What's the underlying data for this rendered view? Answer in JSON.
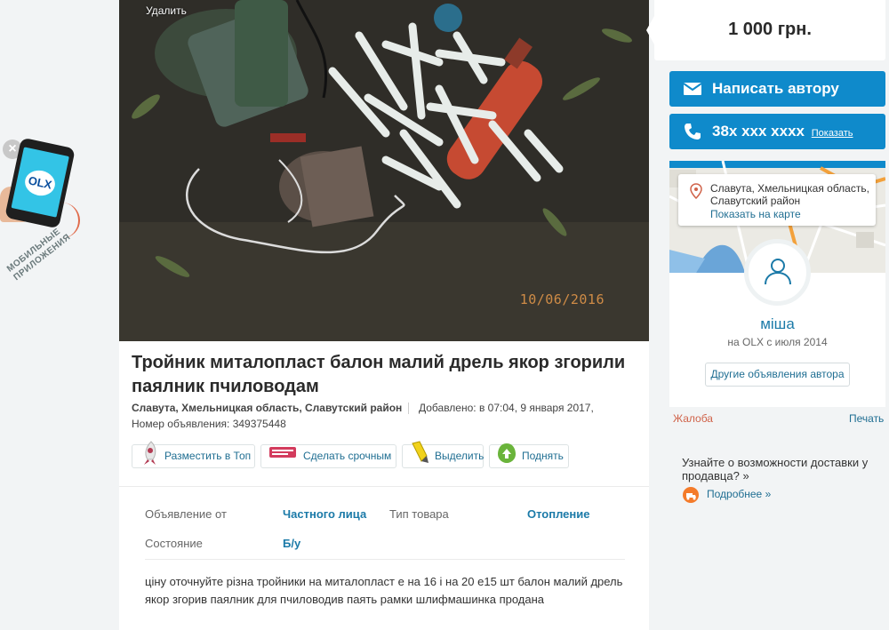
{
  "promo": {
    "close": "×",
    "logo": "OLX",
    "label": "мобильные приложения",
    "icons": [
      "close-icon",
      "phone-icon",
      "arrow-icon"
    ]
  },
  "photo": {
    "delete_label": "Удалить",
    "date_stamp": "10/06/2016"
  },
  "ad": {
    "title": "Тройник миталопласт балон малий дрель якор згорили паялник пчиловодам",
    "location": "Славута, Хмельницкая область, Славутский район",
    "added": "Добавлено: в 07:04, 9 января 2017,",
    "ad_number": "Номер объявления: 349375448"
  },
  "actions": [
    {
      "label": "Разместить в Топ",
      "icon": "rocket-icon"
    },
    {
      "label": "Сделать срочным",
      "icon": "urgent-tag-icon"
    },
    {
      "label": "Выделить",
      "icon": "marker-icon"
    },
    {
      "label": "Поднять",
      "icon": "up-arrow-icon"
    }
  ],
  "params": [
    {
      "key": "Объявление от",
      "value": "Частного лица"
    },
    {
      "key": "Тип товара",
      "value": "Отопление"
    },
    {
      "key": "Состояние",
      "value": "Б/у"
    }
  ],
  "description": "ціну оточнуйте різна тройники на миталопласт е на 16 і на 20 е15 шт балон малий дрель якор згорив паялник для пчиловодив паять рамки шлифмашинка продана",
  "sidebar": {
    "price": "1 000 грн.",
    "write_author": "Написать автору",
    "phone": "38x xxx xxxx",
    "phone_show": "Показать",
    "map_popup": {
      "address": "Славута, Хмельницкая область, Славутский район",
      "show_on_map": "Показать на карте"
    },
    "user_name": "міша",
    "on_olx_since": "на OLX с июля 2014",
    "other_ads": "Другие объявления автора",
    "complaint": "Жалоба",
    "print": "Печать",
    "delivery_text": "Узнайте о возможности доставки у продавца? »",
    "more": "Подробнее »"
  },
  "colors": {
    "accent": "#0f8acb",
    "link": "#1f6e92",
    "complaint": "#d0634a",
    "text_dark": "#2a2a2a"
  }
}
